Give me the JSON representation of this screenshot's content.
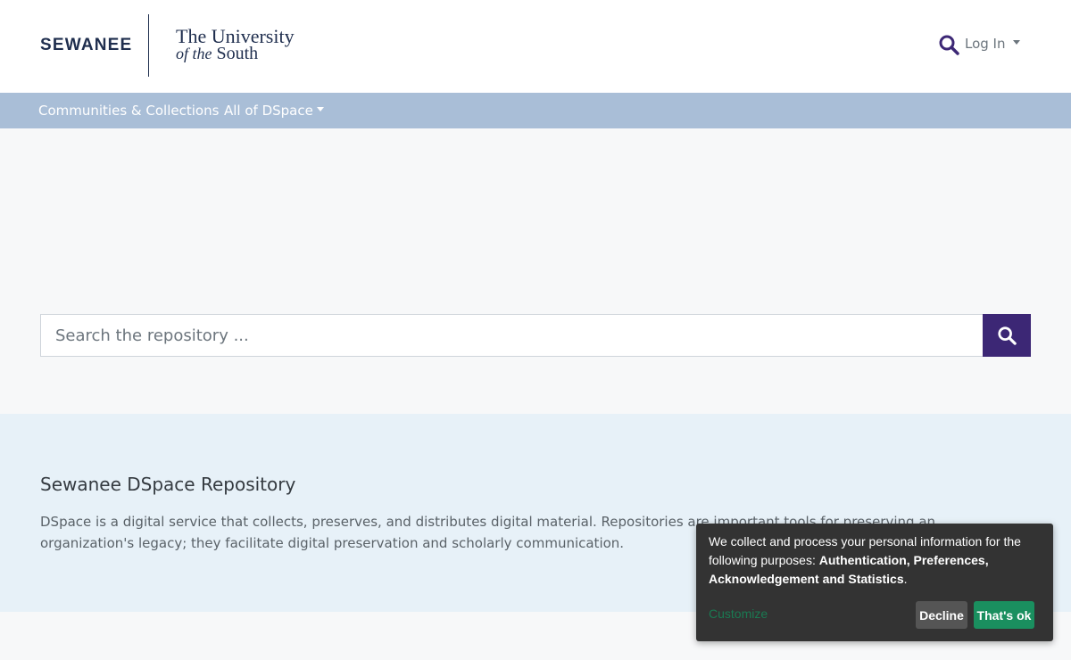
{
  "header": {
    "logo_primary": "SEWANEE",
    "logo_secondary_line1": "The University",
    "logo_secondary_of": "of the",
    "logo_secondary_south": "South",
    "search_icon": "search-icon",
    "login_label": "Log In"
  },
  "nav": {
    "items": [
      {
        "label": "Communities & Collections",
        "has_dropdown": false
      },
      {
        "label": "All of DSpace",
        "has_dropdown": true
      }
    ]
  },
  "search": {
    "placeholder": "Search the repository ...",
    "value": "",
    "button_icon": "search-icon"
  },
  "intro": {
    "title": "Sewanee DSpace Repository",
    "text": "DSpace is a digital service that collects, preserves, and distributes digital material. Repositories are important tools for preserving an organization's legacy; they facilitate digital preservation and scholarly communication."
  },
  "cookie": {
    "text_prefix": "We collect and process your personal information for the following purposes: ",
    "purposes": "Authentication, Preferences, Acknowledgement and Statistics",
    "text_suffix": ".",
    "customize_label": "Customize",
    "decline_label": "Decline",
    "accept_label": "That's ok"
  },
  "colors": {
    "brand_purple": "#3c2775",
    "navbar_bg": "#a9bed7",
    "intro_bg": "#e7f1f8",
    "accept_green": "#1a8f5f"
  }
}
